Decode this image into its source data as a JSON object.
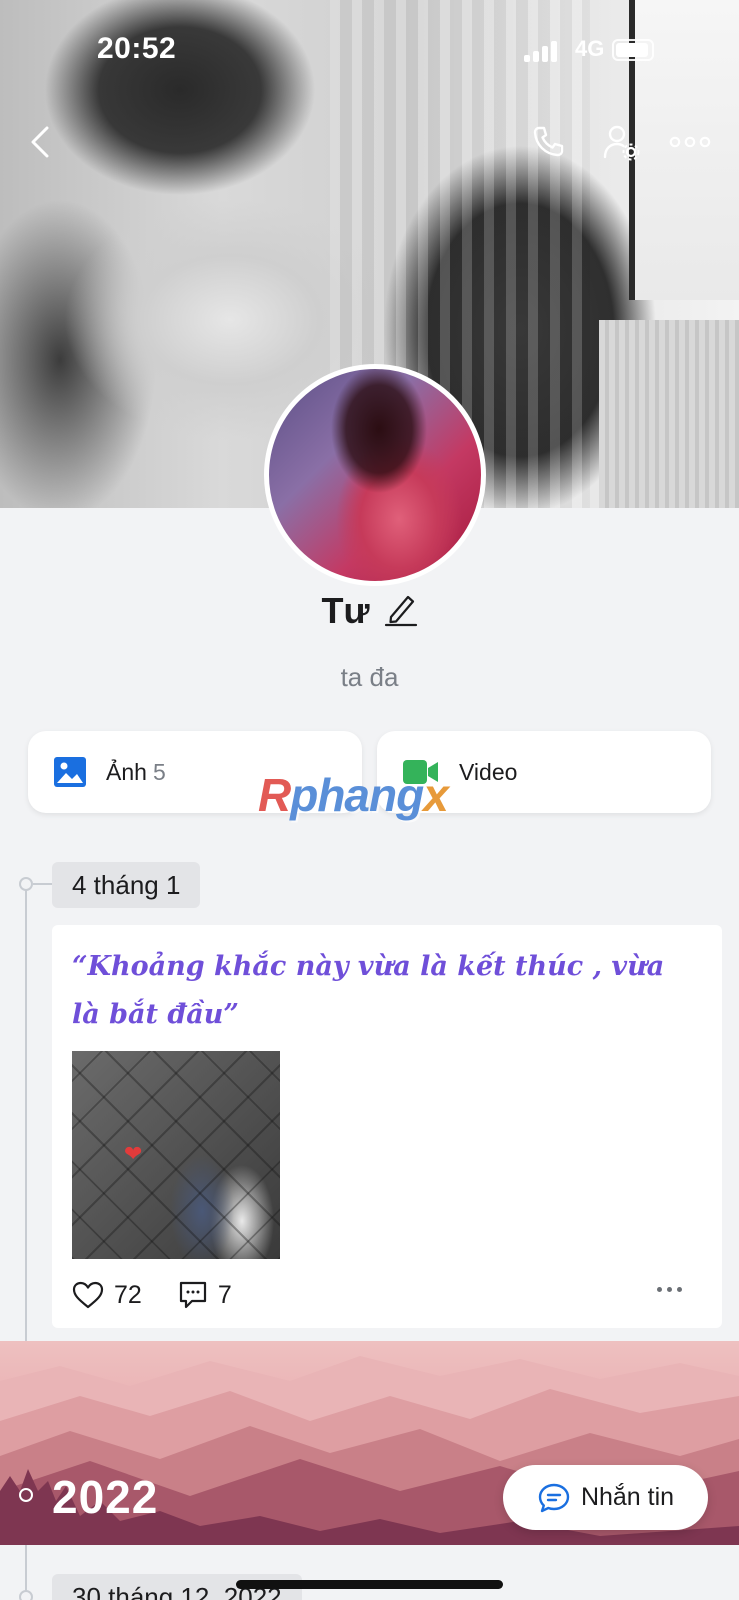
{
  "status_bar": {
    "time": "20:52",
    "network": "4G"
  },
  "header": {
    "back_icon": "chevron-left-icon",
    "call_icon": "phone-icon",
    "settings_icon": "user-settings-icon",
    "more_icon": "more-horizontal-icon"
  },
  "profile": {
    "name": "Tư",
    "bio": "ta đa",
    "edit_icon": "pencil-icon"
  },
  "media": {
    "photos": {
      "label": "Ảnh",
      "count": "5",
      "icon": "image-icon",
      "color": "#1a6fe0"
    },
    "videos": {
      "label": "Video",
      "icon": "video-camera-icon",
      "color": "#34b35a"
    }
  },
  "watermark": {
    "r": "R",
    "middle": "phang",
    "x": "x"
  },
  "timeline": {
    "post_date": "4 tháng 1",
    "post": {
      "text": "“Khoảng khắc này vừa là kết thúc , vừa là bắt đầu”",
      "likes": "72",
      "comments": "7"
    },
    "year": "2022",
    "next_date": "30 tháng 12, 2022"
  },
  "message_button": {
    "label": "Nhắn tin",
    "icon": "chat-bubble-icon"
  },
  "colors": {
    "accent": "#1a6fe0",
    "quote": "#6f4fd9",
    "background": "#f2f3f5"
  }
}
